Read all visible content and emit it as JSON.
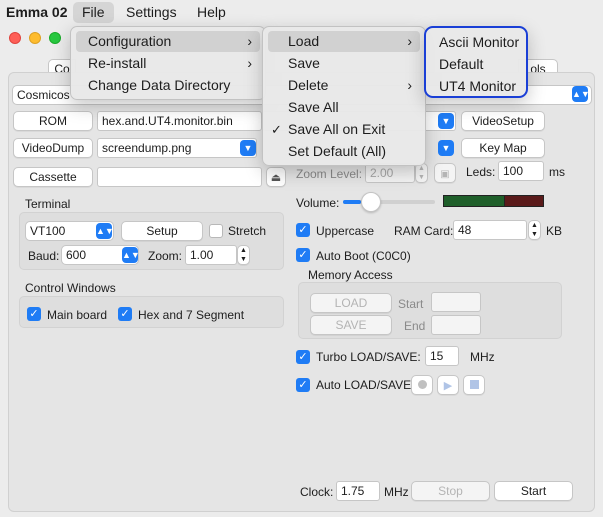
{
  "menubar": {
    "app": "Emma 02",
    "items": [
      "File",
      "Settings",
      "Help"
    ]
  },
  "file_menu": {
    "items": [
      "Configuration",
      "Re-install",
      "Change Data Directory"
    ]
  },
  "config_menu": {
    "items": [
      "Load",
      "Save",
      "Delete",
      "Save All",
      "Save All on Exit",
      "Set Default (All)"
    ]
  },
  "load_menu": {
    "items": [
      "Ascii Monitor",
      "Default",
      "UT4 Monitor"
    ]
  },
  "main": {
    "tab_left_partial": "Co",
    "tab_right_partial": "ols",
    "computer_select": "Cosmicos",
    "rom_button": "ROM",
    "rom_file": "hex.and.UT4.monitor.bin",
    "videodump_button": "VideoDump",
    "videodump_file": "screendump.png",
    "cassette_button": "Cassette",
    "cassette_file": "",
    "videosetup_button": "VideoSetup",
    "keymap_button": "Key Map",
    "zoom_level_label": "Zoom Level:",
    "zoom_level_value": "2.00",
    "leds_label": "Leds:",
    "leds_value": "100",
    "leds_unit": "ms",
    "volume_label": "Volume:",
    "volume_level": 0.2
  },
  "terminal": {
    "title": "Terminal",
    "type": "VT100",
    "setup_button": "Setup",
    "stretch_label": "Stretch",
    "baud_label": "Baud:",
    "baud_value": "600",
    "zoom_label": "Zoom:",
    "zoom_value": "1.00"
  },
  "control_windows": {
    "title": "Control Windows",
    "main_board": "Main board",
    "hex_segment": "Hex and 7 Segment"
  },
  "options": {
    "uppercase": "Uppercase",
    "ram_card_label": "RAM Card:",
    "ram_card_value": "48",
    "ram_card_unit": "KB",
    "autoboot": "Auto Boot (C0C0)"
  },
  "memory_access": {
    "title": "Memory Access",
    "load_button": "LOAD",
    "save_button": "SAVE",
    "start_label": "Start",
    "end_label": "End"
  },
  "turbo": {
    "label": "Turbo LOAD/SAVE:",
    "value": "15",
    "unit": "MHz"
  },
  "autoload": {
    "label": "Auto LOAD/SAVE"
  },
  "clock": {
    "label": "Clock:",
    "value": "1.75",
    "unit": "MHz",
    "stop_button": "Stop",
    "start_button": "Start"
  },
  "colors": {
    "accent": "#1f7cf5",
    "annotation": "#1a3fd6"
  }
}
